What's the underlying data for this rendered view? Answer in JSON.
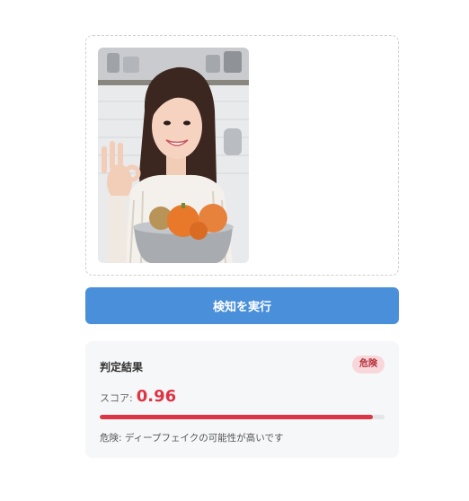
{
  "button": {
    "label": "検知を実行"
  },
  "result": {
    "title": "判定結果",
    "badge": "危険",
    "score_label": "スコア:",
    "score": 0.96,
    "score_text": "0.96",
    "message": "危険: ディープフェイクの可能性が高いです"
  },
  "colors": {
    "accent": "#4a8fd9",
    "danger": "#dc3545",
    "badge_bg": "#f8d7da"
  }
}
